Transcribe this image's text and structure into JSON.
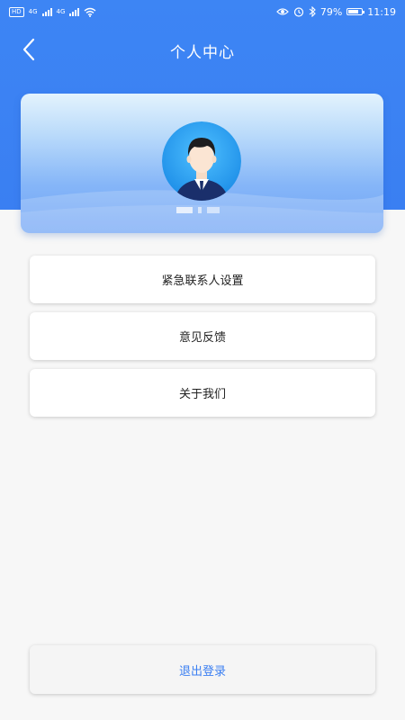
{
  "status_bar": {
    "left_badge": "HD",
    "net1": "4G",
    "net2": "4G",
    "battery_pct": "79%",
    "time": "11:19",
    "battery_level": 0.79,
    "icons": [
      "hd-icon",
      "signal-icon",
      "wifi-icon",
      "eye-icon",
      "alarm-icon",
      "bluetooth-icon",
      "battery-icon"
    ]
  },
  "nav": {
    "title": "个人中心",
    "back_icon": "chevron-left-icon"
  },
  "profile": {
    "avatar_icon": "user-avatar-icon",
    "username": ""
  },
  "menu": {
    "items": [
      {
        "label": "紧急联系人设置"
      },
      {
        "label": "意见反馈"
      },
      {
        "label": "关于我们"
      }
    ]
  },
  "logout": {
    "label": "退出登录"
  },
  "colors": {
    "primary": "#3b7ff2",
    "background": "#f7f7f7",
    "card": "#ffffff"
  }
}
